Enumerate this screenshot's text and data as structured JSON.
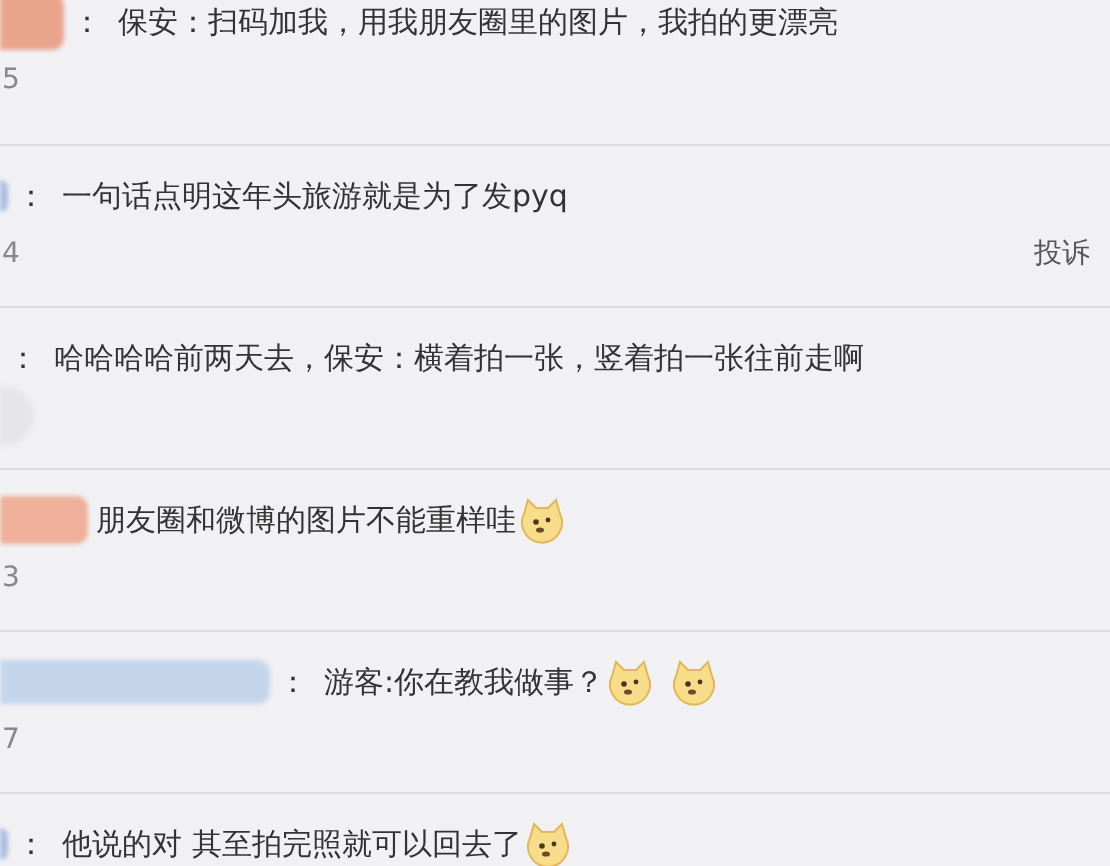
{
  "comments": [
    {
      "name_blur": {
        "color": "#e9a58c",
        "kind": "medium"
      },
      "separator": "：",
      "text": "保安：扫码加我，用我朋友圈里的图片，我拍的更漂亮",
      "meta": "5"
    },
    {
      "name_blur": {
        "color": "#a9bde0",
        "kind": "tiny"
      },
      "separator": "：",
      "text": "一句话点明这年头旅游就是为了发pyq",
      "meta": "4",
      "report": "投诉"
    },
    {
      "separator": "：",
      "text": "哈哈哈哈前两天去，保安：横着拍一张，竖着拍一张往前走啊",
      "avatar_blur": true
    },
    {
      "name_blur": {
        "color": "#eeb09a",
        "kind": "large"
      },
      "text": "朋友圈和微博的图片不能重样哇",
      "emojis": [
        {
          "kind": "doge"
        }
      ],
      "meta": "3"
    },
    {
      "name_blur": {
        "color": "#c5d5ec",
        "kind": "long"
      },
      "separator": "：",
      "text": "游客:你在教我做事？",
      "emojis": [
        {
          "kind": "doge"
        },
        {
          "kind": "doge"
        }
      ],
      "meta": "7"
    },
    {
      "name_blur": {
        "color": "#a9bde0",
        "kind": "tiny"
      },
      "separator": "：",
      "text": "他说的对 其至拍完照就可以回去了",
      "emojis": [
        {
          "kind": "doge"
        }
      ]
    }
  ]
}
